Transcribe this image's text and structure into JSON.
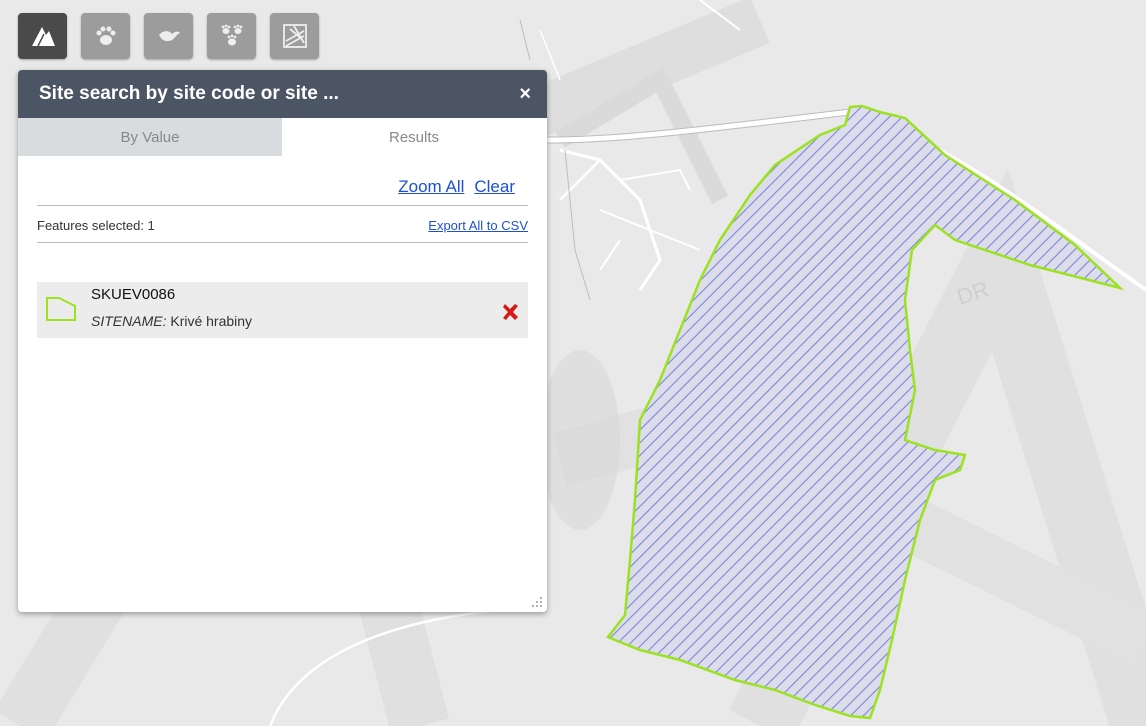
{
  "toolbar": {
    "buttons": [
      {
        "icon": "mountain-icon",
        "active": true
      },
      {
        "icon": "paw-icon",
        "active": false
      },
      {
        "icon": "bird-icon",
        "active": false
      },
      {
        "icon": "paw-group-icon",
        "active": false
      },
      {
        "icon": "habitat-icon",
        "active": false
      }
    ]
  },
  "panel": {
    "title": "Site search by site code or site ...",
    "close_icon": "×",
    "tabs": [
      {
        "label": "By Value",
        "selected": false
      },
      {
        "label": "Results",
        "selected": true
      }
    ],
    "actions": {
      "zoom_all": "Zoom All",
      "clear": "Clear"
    },
    "features_selected": "Features selected: 1",
    "export_csv": "Export All to CSV",
    "results": [
      {
        "code": "SKUEV0086",
        "attr_label": "SITENAME:",
        "attr_value": " Krivé hrabiny"
      }
    ]
  },
  "map": {
    "polygon_outline_color": "#9be21f",
    "hatch_color": "#7b86d8",
    "watermark_text": "DRAFT",
    "road_label": "DR"
  }
}
